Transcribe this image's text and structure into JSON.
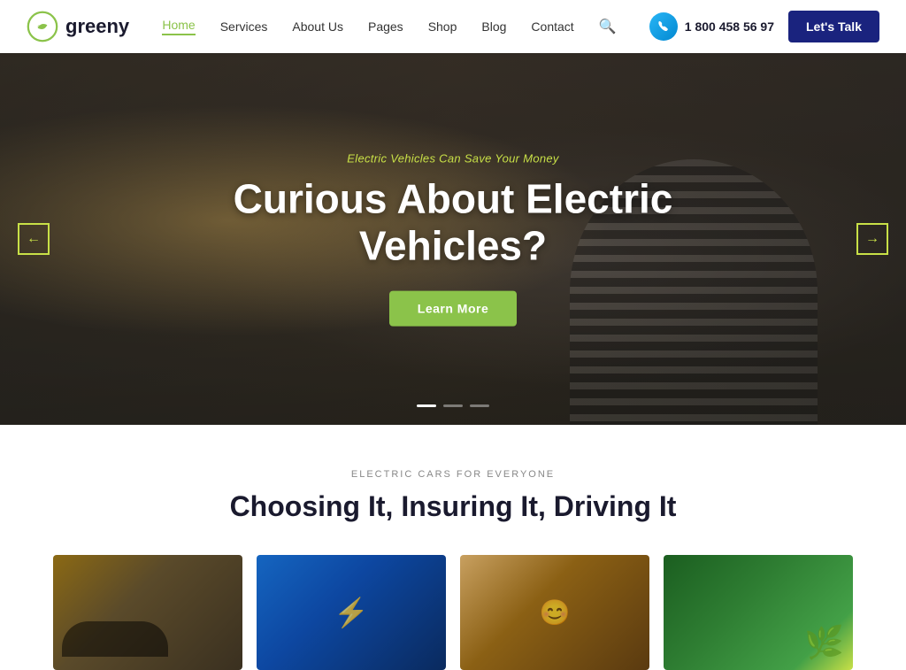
{
  "brand": {
    "name": "greeny"
  },
  "nav": {
    "links": [
      {
        "label": "Home",
        "active": true
      },
      {
        "label": "Services",
        "active": false
      },
      {
        "label": "About Us",
        "active": false
      },
      {
        "label": "Pages",
        "active": false
      },
      {
        "label": "Shop",
        "active": false
      },
      {
        "label": "Blog",
        "active": false
      },
      {
        "label": "Contact",
        "active": false
      }
    ]
  },
  "header": {
    "phone": "1 800 458 56 97",
    "cta_label": "Let's Talk"
  },
  "hero": {
    "subtitle": "Electric Vehicles Can Save Your Money",
    "title": "Curious About Electric Vehicles?",
    "button_label": "Learn More",
    "arrow_left": "←",
    "arrow_right": "→",
    "dots": [
      {
        "active": true
      },
      {
        "active": false
      },
      {
        "active": false
      }
    ]
  },
  "section": {
    "label": "ELECTRIC CARS FOR EVERYONE",
    "title": "Choosing It, Insuring It, Driving It"
  },
  "cards": [
    {
      "id": 1,
      "alt": "Electric car"
    },
    {
      "id": 2,
      "alt": "Charging port"
    },
    {
      "id": 3,
      "alt": "Happy drivers"
    },
    {
      "id": 4,
      "alt": "Green leaf"
    }
  ]
}
